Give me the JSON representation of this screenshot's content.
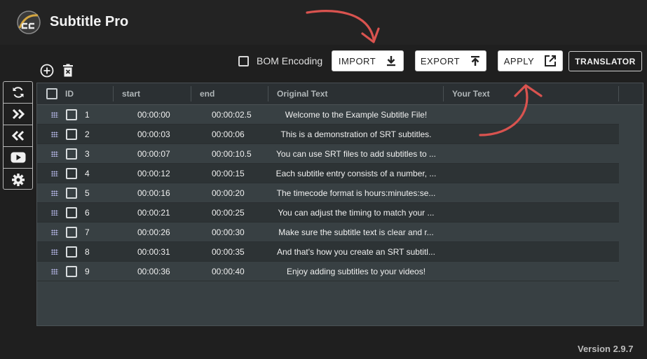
{
  "app": {
    "title": "Subtitle Pro",
    "version": "Version 2.9.7"
  },
  "toolbar": {
    "bom_label": "BOM Encoding",
    "import_label": "IMPORT",
    "export_label": "EXPORT",
    "apply_label": "APPLY",
    "translator_label": "TRANSLATOR"
  },
  "sidebar": {
    "items": [
      {
        "icon": "sync-icon"
      },
      {
        "icon": "double-chevron-right-icon"
      },
      {
        "icon": "double-chevron-left-icon"
      },
      {
        "icon": "youtube-icon"
      },
      {
        "icon": "gear-icon"
      }
    ]
  },
  "table": {
    "columns": [
      "ID",
      "start",
      "end",
      "Original Text",
      "Your Text"
    ],
    "rows": [
      {
        "id": "1",
        "start": "00:00:00",
        "end": "00:00:02.5",
        "text": "Welcome to the Example Subtitle File!"
      },
      {
        "id": "2",
        "start": "00:00:03",
        "end": "00:00:06",
        "text": "This is a demonstration of SRT subtitles."
      },
      {
        "id": "3",
        "start": "00:00:07",
        "end": "00:00:10.5",
        "text": "You can use SRT files to add subtitles to ..."
      },
      {
        "id": "4",
        "start": "00:00:12",
        "end": "00:00:15",
        "text": "Each subtitle entry consists of a number, ..."
      },
      {
        "id": "5",
        "start": "00:00:16",
        "end": "00:00:20",
        "text": "The timecode format is hours:minutes:se..."
      },
      {
        "id": "6",
        "start": "00:00:21",
        "end": "00:00:25",
        "text": "You can adjust the timing to match your ..."
      },
      {
        "id": "7",
        "start": "00:00:26",
        "end": "00:00:30",
        "text": "Make sure the subtitle text is clear and r..."
      },
      {
        "id": "8",
        "start": "00:00:31",
        "end": "00:00:35",
        "text": "And that's how you create an SRT subtitl..."
      },
      {
        "id": "9",
        "start": "00:00:36",
        "end": "00:00:40",
        "text": "Enjoy adding subtitles to your videos!"
      }
    ]
  },
  "colors": {
    "background": "#1f1f1f",
    "table_bg": "#384043",
    "annotation_arrow": "#e05a5a"
  }
}
